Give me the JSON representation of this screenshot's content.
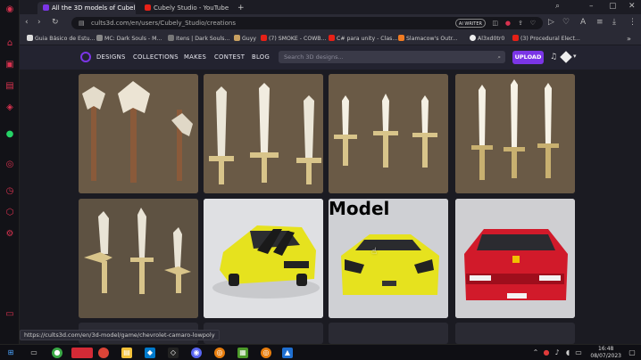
{
  "browser": {
    "tabs": [
      {
        "label": "All the 3D models of Cubel"
      },
      {
        "label": "Cubely Studio - YouTube"
      }
    ],
    "new_tab": "+",
    "url": "cults3d.com/en/users/Cubely_Studio/creations",
    "extension_badge": "AI WRITER",
    "bookmarks": [
      "Guia Básico de Estu...",
      "MC: Dark Souls - M...",
      "Itens | Dark Souls...",
      "Guyy",
      "(7) SMOKE - COWB...",
      "C# para unity - Clas...",
      "Slamacow's Outr...",
      "Al3xd0tr0",
      "(3) Procedural Elect..."
    ]
  },
  "site": {
    "nav": [
      "DESIGNS",
      "COLLECTIONS",
      "MAKES",
      "CONTEST",
      "BLOG"
    ],
    "search_placeholder": "Search 3D designs...",
    "upload_label": "UPLOAD"
  },
  "gallery": {
    "overlay_text": "Model",
    "status_url": "https://cults3d.com/en/3d-model/game/chevrolet-camaro-lowpoly"
  },
  "taskbar": {
    "time": "16:48",
    "date": "08/07/2023"
  },
  "colors": {
    "accent": "#7b35e6",
    "background": "#1b1b22",
    "car_yellow": "#e6e21e",
    "car_red": "#d11a2a"
  }
}
